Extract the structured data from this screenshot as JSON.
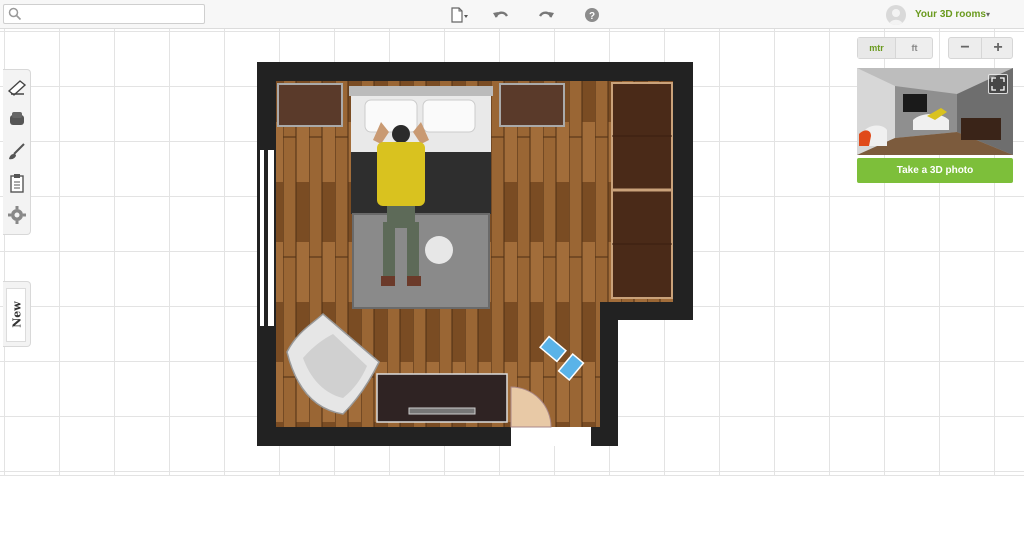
{
  "topbar": {
    "search": {
      "value": "",
      "placeholder": ""
    },
    "icons": [
      "search-icon",
      "new-document-icon",
      "undo-icon",
      "redo-icon",
      "help-icon"
    ],
    "user": {
      "label": "Your 3D rooms",
      "caret": "▾"
    }
  },
  "left_toolbar": {
    "tools": [
      "floor-brush-icon",
      "furniture-icon",
      "paint-icon",
      "clipboard-icon",
      "settings-icon"
    ],
    "new_tab_label": "New"
  },
  "right_panel": {
    "units": {
      "metric": "mtr",
      "imperial": "ft",
      "selected": "mtr"
    },
    "zoom": {
      "out": "−",
      "in": "+"
    },
    "take_photo_label": "Take a 3D photo"
  },
  "colors": {
    "accent": "#7dbf3a",
    "accent_text": "#6a9a1e",
    "wall": "#222222",
    "floor": "#8a5a2e"
  }
}
